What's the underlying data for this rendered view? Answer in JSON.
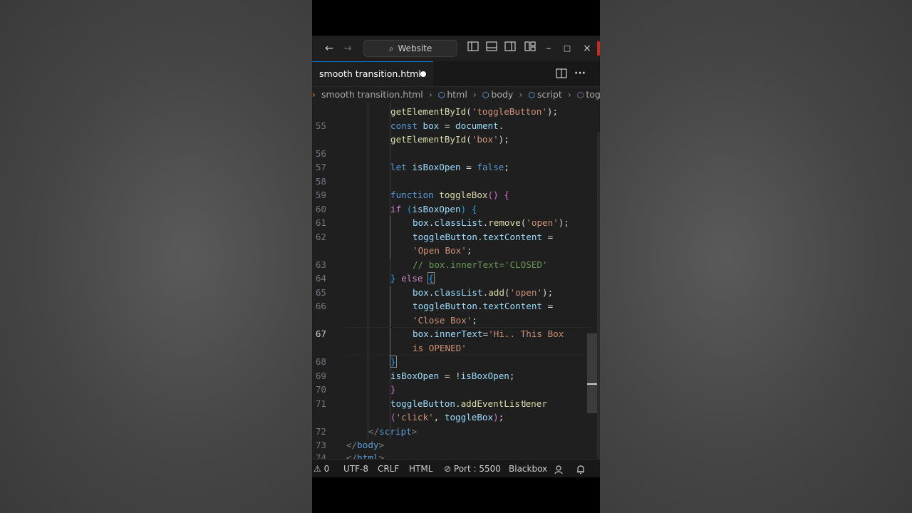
{
  "titlebar": {
    "back_icon": "←",
    "forward_icon": "→",
    "search_text": "Website",
    "search_icon": "⌕",
    "layout_icons": [
      "sidebar-left-icon",
      "panel-bottom-icon",
      "sidebar-right-icon",
      "customize-layout-icon"
    ],
    "minimize": "–",
    "maximize": "□",
    "close": "×"
  },
  "tab": {
    "title": "smooth transition.html",
    "modified": true
  },
  "tab_actions": {
    "split": "◫",
    "more": "···"
  },
  "breadcrumbs": {
    "prefix": "<>",
    "file": "smooth transition.html",
    "items": [
      "html",
      "body",
      "script",
      "togg"
    ]
  },
  "code": {
    "current_line": "67",
    "lines": {
      "l54b": "getElementById('toggleButton');",
      "l55": "55",
      "l56": "56",
      "l57": "57",
      "l58": "58",
      "l59": "59",
      "l60": "60",
      "l61": "61",
      "l62": "62",
      "l63": "63",
      "l64": "64",
      "l65": "65",
      "l66": "66",
      "l67": "67",
      "l68": "68",
      "l69": "69",
      "l70": "70",
      "l71": "71",
      "l72": "72",
      "l73": "73",
      "l74": "74"
    }
  },
  "statusbar": {
    "problems": "0",
    "encoding": "UTF-8",
    "eol": "CRLF",
    "language": "HTML",
    "port": "Port : 5500",
    "extension": "Blackbox"
  },
  "colors": {
    "editor_bg": "#1f1f1f",
    "accent": "#0078d4",
    "function": "#dcdcaa",
    "keyword": "#569cd6",
    "string": "#ce9178",
    "comment": "#6a9955"
  }
}
